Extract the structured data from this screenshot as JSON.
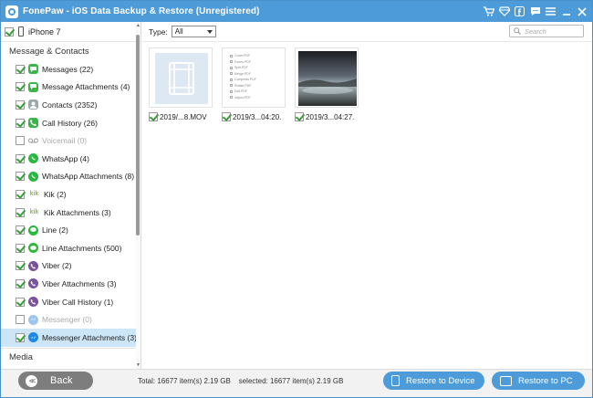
{
  "app": {
    "title": "FonePaw - iOS Data Backup & Restore (Unregistered)",
    "accent": "#4d9bd8"
  },
  "titlebar_icons": [
    "cart-icon",
    "diamond-icon",
    "facebook-icon",
    "chat-icon",
    "menu-icon",
    "minimize-icon",
    "close-icon"
  ],
  "device": {
    "name": "iPhone 7",
    "checked": true
  },
  "sidebar": {
    "section_messages": "Message & Contacts",
    "items": [
      {
        "label": "Messages (22)",
        "checked": true,
        "icon": "messages-icon",
        "dim": false
      },
      {
        "label": "Message Attachments (4)",
        "checked": true,
        "icon": "message-attachments-icon",
        "dim": false
      },
      {
        "label": "Contacts (2352)",
        "checked": true,
        "icon": "contacts-icon",
        "dim": false
      },
      {
        "label": "Call History (26)",
        "checked": true,
        "icon": "phone-icon",
        "dim": false
      },
      {
        "label": "Voicemail (0)",
        "checked": false,
        "icon": "voicemail-icon",
        "dim": true
      },
      {
        "label": "WhatsApp (4)",
        "checked": true,
        "icon": "whatsapp-icon",
        "dim": false
      },
      {
        "label": "WhatsApp Attachments (8)",
        "checked": true,
        "icon": "whatsapp-icon",
        "dim": false
      },
      {
        "label": "Kik (2)",
        "checked": true,
        "icon": "kik-icon",
        "dim": false
      },
      {
        "label": "Kik Attachments (3)",
        "checked": true,
        "icon": "kik-icon",
        "dim": false
      },
      {
        "label": "Line (2)",
        "checked": true,
        "icon": "line-icon",
        "dim": false
      },
      {
        "label": "Line Attachments (500)",
        "checked": true,
        "icon": "line-icon",
        "dim": false
      },
      {
        "label": "Viber (2)",
        "checked": true,
        "icon": "viber-icon",
        "dim": false
      },
      {
        "label": "Viber Attachments (3)",
        "checked": true,
        "icon": "viber-icon",
        "dim": false
      },
      {
        "label": "Viber Call History (1)",
        "checked": true,
        "icon": "viber-icon",
        "dim": false
      },
      {
        "label": "Messenger (0)",
        "checked": false,
        "icon": "messenger-icon",
        "dim": true
      },
      {
        "label": "Messenger Attachments (3)",
        "checked": true,
        "icon": "messenger-icon",
        "dim": false,
        "selected": true
      }
    ],
    "section_media": "Media"
  },
  "toolbar": {
    "type_label": "Type:",
    "type_value": "All",
    "search_placeholder": "Search"
  },
  "files": [
    {
      "caption": "2019/...8.MOV",
      "kind": "video",
      "checked": true
    },
    {
      "caption": "2019/3...04:20.",
      "kind": "document",
      "checked": true
    },
    {
      "caption": "2019/3...04:27.",
      "kind": "photo",
      "checked": true
    }
  ],
  "document_lines": [
    "Cover.PDF",
    "Forms.PDF",
    "Split.PDF",
    "Merge.PDF",
    "Compress.PDF",
    "Rotate.PDF",
    "Edit.PDF",
    "Adjust.PDF"
  ],
  "footer": {
    "back_label": "Back",
    "total_text": "Total: 16677 item(s) 2.19 GB",
    "selected_text": "selected: 16677 item(s) 2.19 GB",
    "restore_device_label": "Restore to Device",
    "restore_pc_label": "Restore to PC"
  }
}
